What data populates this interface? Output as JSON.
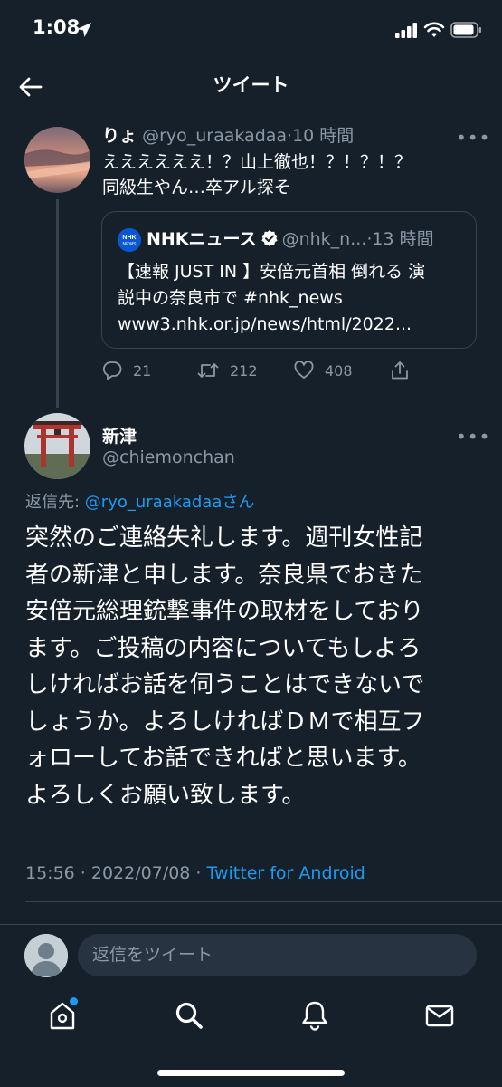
{
  "status_bar": {
    "time": "1:08"
  },
  "header": {
    "title": "ツイート"
  },
  "parent_tweet": {
    "name": "りょ",
    "handle": "@ryo_uraakadaa",
    "time": "10 時間",
    "text_line1": "ええええええ！？山上徹也！？！？！？",
    "text_line2": "同級生やん…卒アル探そ"
  },
  "quote_tweet": {
    "logo_text": "NHK NEWS",
    "name": "NHKニュース",
    "handle": "@nhk_n...",
    "time": "13 時間",
    "text_line1": "【速報 JUST IN 】安倍元首相 倒れる 演",
    "text_line2": "説中の奈良市で #nhk_news",
    "text_line3": "www3.nhk.or.jp/news/html/2022..."
  },
  "actions": {
    "replies": "21",
    "retweets": "212",
    "likes": "408"
  },
  "main_tweet": {
    "name": "新津",
    "handle": "@chiemonchan",
    "reply_prefix": "返信先: ",
    "reply_to": "@ryo_uraakadaa",
    "reply_suffix": "さん",
    "text_lines": [
      "突然のご連絡失礼します。週刊女性記",
      "者の新津と申します。奈良県でおきた",
      "安倍元総理銃撃事件の取材をしており",
      "ます。ご投稿の内容についてもしよろ",
      "しければお話を伺うことはできないで",
      "しょうか。よろしければＤＭで相互フ",
      "ォローしてお話できればと思います。",
      "よろしくお願い致します。"
    ],
    "timestamp": "15:56 · 2022/07/08 · ",
    "source": "Twitter for Android"
  },
  "composer": {
    "placeholder": "返信をツイート"
  },
  "tab_bar": {
    "items": [
      "home-icon",
      "search-icon",
      "notifications-icon",
      "messages-icon"
    ]
  },
  "colors": {
    "background": "#15202b",
    "accent": "#1d9bf0",
    "muted": "#8b98a5",
    "border": "#38444d"
  }
}
